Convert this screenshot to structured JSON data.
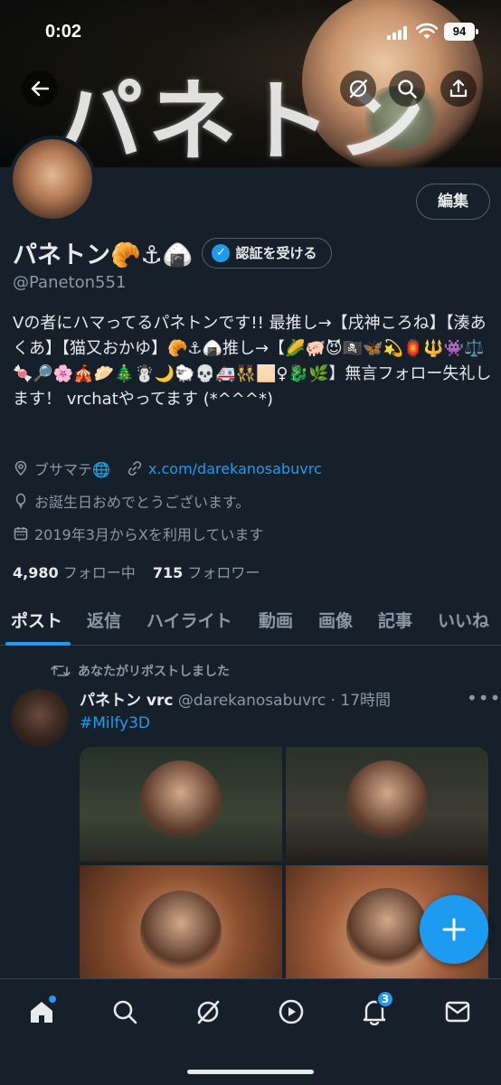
{
  "status": {
    "time": "0:02",
    "battery": "94"
  },
  "banner": {
    "text": "パネトン"
  },
  "profile": {
    "edit_label": "編集",
    "display_name": "パネトン🥐⚓🍙",
    "verify_label": "認証を受ける",
    "handle": "@Paneton551",
    "bio": "Vの者にハマってるパネトンです!! 最推し→【戌神ころね】【湊あくあ】【猫又おかゆ】🥐⚓🍙推し→【🌽🐖😈🏴‍☠️🦋💫🏮🔱👾⚖️🍬🔎🌸🎪🥟🎄☃️🌙🐑💀🚑👯🏻♀🐉🌿】無言フォロー失礼します！ vrchatやってます (*^^^*)",
    "location": "ブサマテ🌐",
    "link": "x.com/darekanosabuvrc",
    "birthday": "お誕生日おめでとうございます。",
    "joined": "2019年3月からXを利用しています",
    "following_count": "4,980",
    "following_label": "フォロー中",
    "followers_count": "715",
    "followers_label": "フォロワー"
  },
  "tabs": [
    "ポスト",
    "返信",
    "ハイライト",
    "動画",
    "画像",
    "記事",
    "いいね"
  ],
  "post": {
    "repost_label": "あなたがリポストしました",
    "author": "パネトン vrc",
    "handle": "@darekanosabuvrc",
    "time": "· 17時間",
    "hashtag": "#Milfy3D"
  },
  "nav": {
    "notifications_badge": "3"
  },
  "colors": {
    "accent": "#1d9bf0",
    "background": "#15202b"
  }
}
